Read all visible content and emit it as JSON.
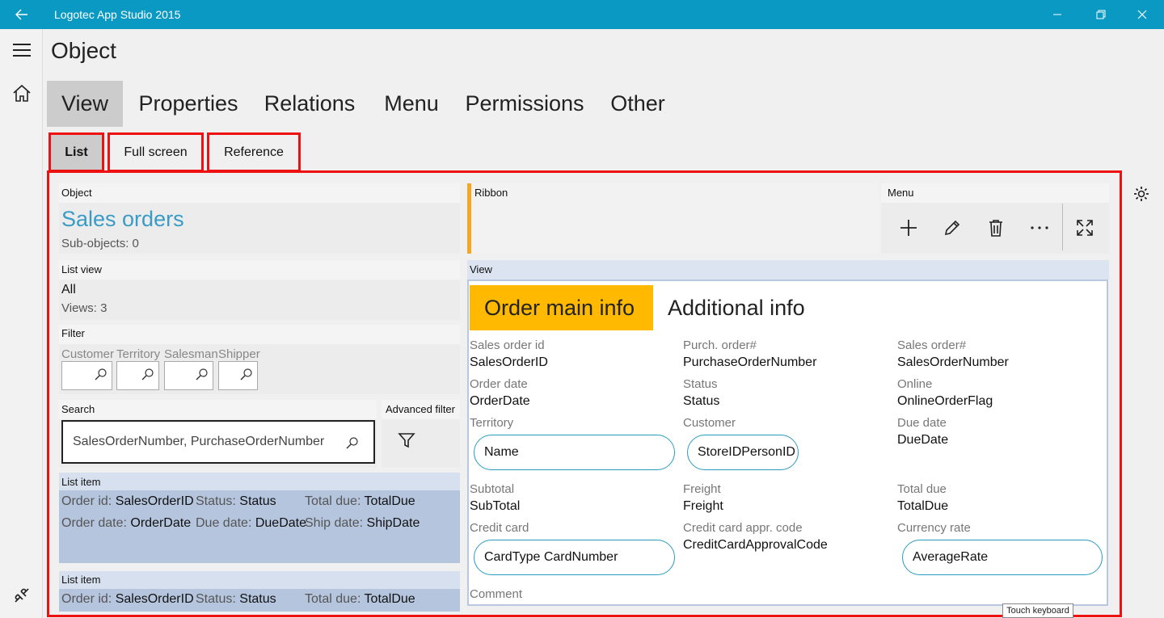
{
  "app": {
    "title": "Logotec App Studio 2015"
  },
  "page": {
    "title": "Object"
  },
  "tabs": [
    "View",
    "Properties",
    "Relations",
    "Menu",
    "Permissions",
    "Other"
  ],
  "subtabs": [
    "List",
    "Full screen",
    "Reference"
  ],
  "object": {
    "label": "Object",
    "name": "Sales orders",
    "subobjects": "Sub-objects: 0"
  },
  "ribbon": {
    "label": "Ribbon"
  },
  "menu": {
    "label": "Menu",
    "icons": [
      "plus-icon",
      "pencil-icon",
      "trash-icon",
      "more-icon",
      "fullscreen-icon"
    ]
  },
  "listview": {
    "label": "List view",
    "value": "All",
    "views": "Views: 3"
  },
  "filter": {
    "label": "Filter",
    "fields": [
      "Customer",
      "Territory",
      "Salesman",
      "Shipper"
    ]
  },
  "search": {
    "label": "Search",
    "value": "SalesOrderNumber, PurchaseOrderNumber"
  },
  "advanced_filter": {
    "label": "Advanced filter"
  },
  "list_item": {
    "label": "List item",
    "order_id_label": "Order id:",
    "order_id": "SalesOrderID",
    "status_label": "Status:",
    "status": "Status",
    "total_due_label": "Total due:",
    "total_due": "TotalDue",
    "order_date_label": "Order date:",
    "order_date": "OrderDate",
    "due_date_label": "Due date:",
    "due_date": "DueDate",
    "ship_date_label": "Ship date:",
    "ship_date": "ShipDate"
  },
  "view": {
    "label": "View",
    "tabs": [
      "Order main info",
      "Additional info"
    ],
    "fields": {
      "sales_order_id": {
        "label": "Sales order id",
        "value": "SalesOrderID"
      },
      "purch_order": {
        "label": "Purch. order#",
        "value": "PurchaseOrderNumber"
      },
      "sales_order_num": {
        "label": "Sales order#",
        "value": "SalesOrderNumber"
      },
      "order_date": {
        "label": "Order date",
        "value": "OrderDate"
      },
      "status": {
        "label": "Status",
        "value": "Status"
      },
      "online": {
        "label": "Online",
        "value": "OnlineOrderFlag"
      },
      "territory": {
        "label": "Territory",
        "value": "Name"
      },
      "customer": {
        "label": "Customer",
        "value": "StoreIDPersonID"
      },
      "due_date": {
        "label": "Due date",
        "value": "DueDate"
      },
      "subtotal": {
        "label": "Subtotal",
        "value": "SubTotal"
      },
      "freight": {
        "label": "Freight",
        "value": "Freight"
      },
      "total_due": {
        "label": "Total due",
        "value": "TotalDue"
      },
      "credit_card": {
        "label": "Credit card",
        "value": "CardType CardNumber"
      },
      "cc_appr": {
        "label": "Credit card appr. code",
        "value": "CreditCardApprovalCode"
      },
      "currency_rate": {
        "label": "Currency rate",
        "value": "AverageRate"
      },
      "comment": {
        "label": "Comment"
      }
    }
  },
  "touch_keyboard": "Touch keyboard",
  "colors": {
    "titlebar": "#0a99c2",
    "accent_tab": "#ffb900",
    "ribbon_bar": "#f5a623",
    "list_item_bg": "#b5c5de",
    "frame": "#ee1111",
    "link": "#3a9bc6"
  }
}
